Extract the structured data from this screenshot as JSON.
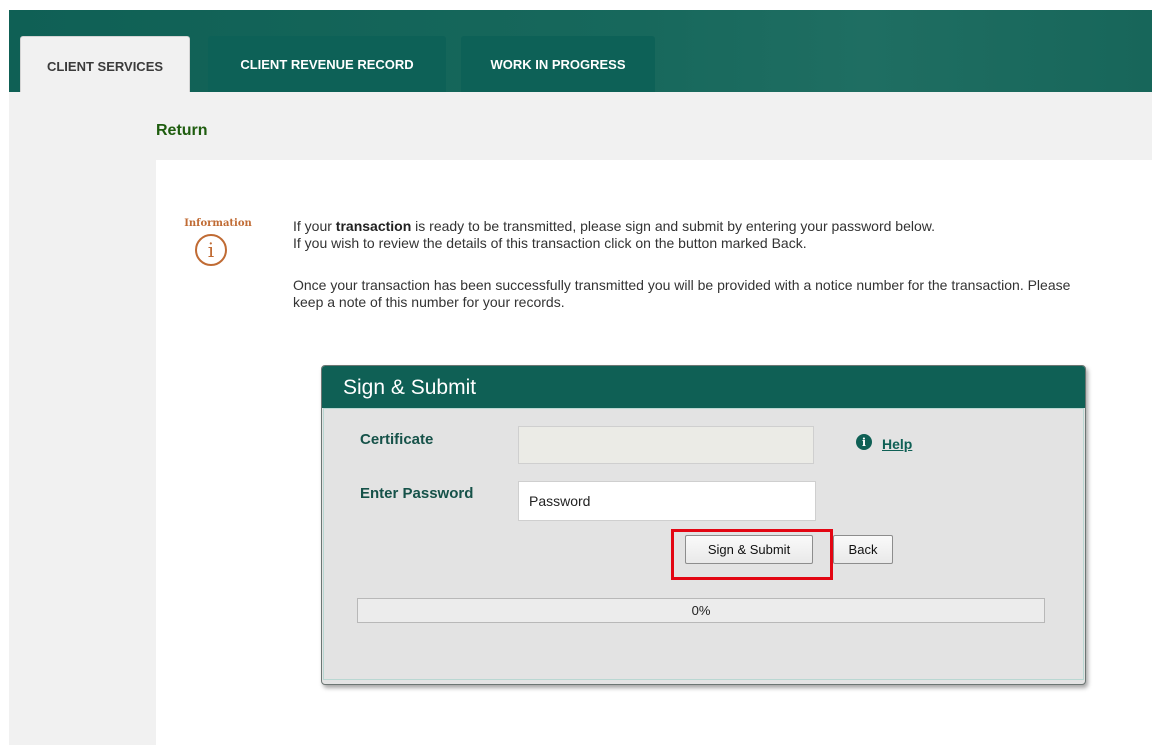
{
  "tabs": [
    {
      "label": "CLIENT SERVICES",
      "active": true
    },
    {
      "label": "CLIENT REVENUE RECORD",
      "active": false
    },
    {
      "label": "WORK IN PROGRESS",
      "active": false
    }
  ],
  "page": {
    "title": "Return"
  },
  "info": {
    "icon_label": "Information",
    "icon_name": "info-icon",
    "line1_pre": "If your ",
    "line1_bold": "transaction",
    "line1_post": " is ready to be transmitted, please sign and submit by entering your password below.",
    "line2": "If you wish to review the details of this transaction click on the button marked Back.",
    "paragraph2": "Once your transaction has been successfully transmitted you will be provided with a notice number for the transaction. Please keep a note of this number for your records."
  },
  "sign_panel": {
    "title": "Sign & Submit",
    "certificate_label": "Certificate",
    "certificate_value": "",
    "password_label": "Enter Password",
    "password_value": "Password",
    "help_label": "Help",
    "submit_label": "Sign & Submit",
    "back_label": "Back",
    "progress_percent": 0,
    "progress_text": "0%"
  },
  "colors": {
    "brand": "#0f6055",
    "highlight": "#e30613",
    "title_green": "#1f5d0f",
    "info_orange": "#c06b34"
  }
}
